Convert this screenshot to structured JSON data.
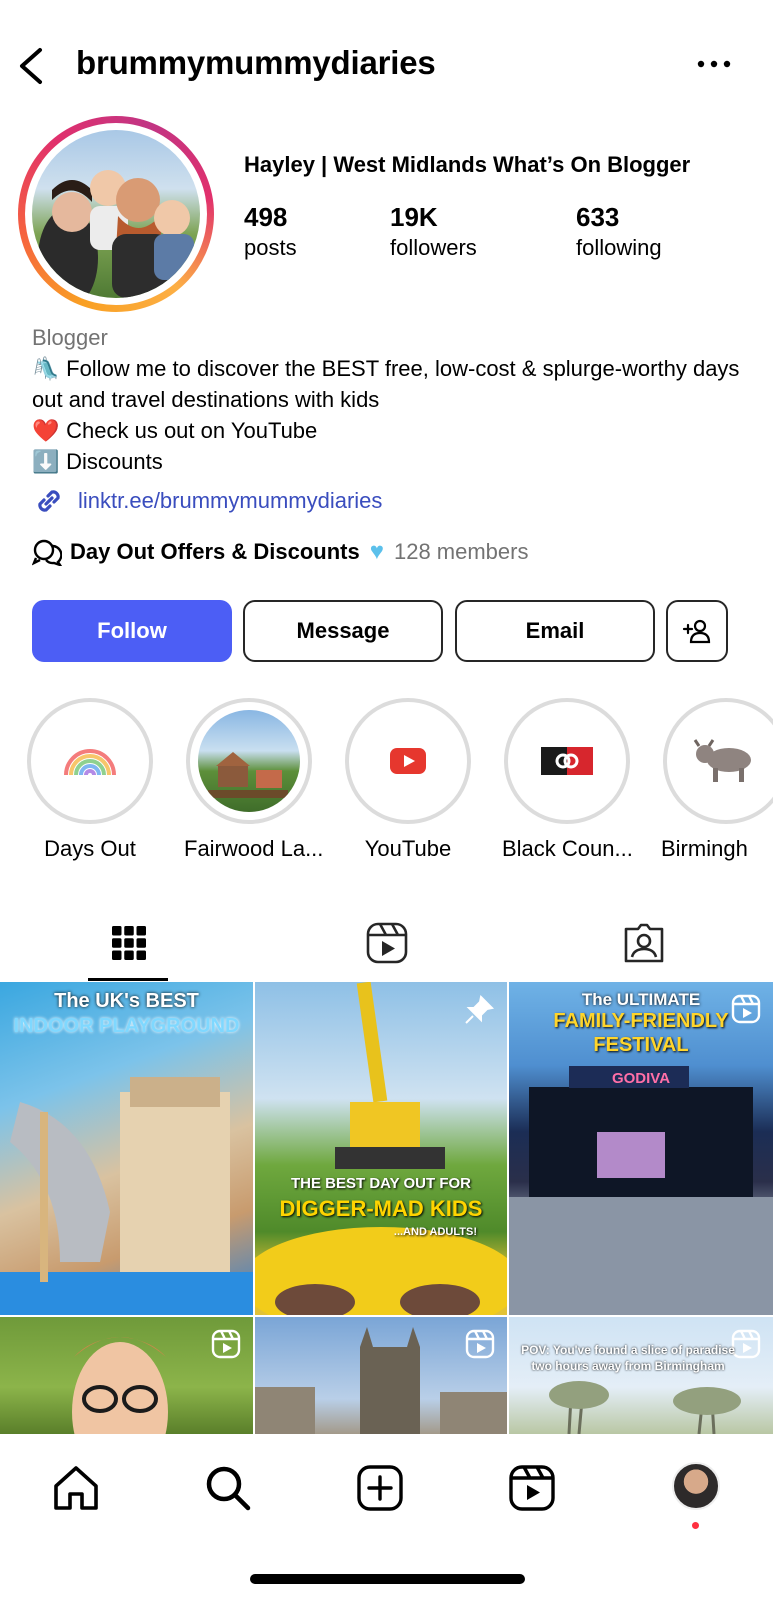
{
  "header": {
    "username": "brummymummydiaries",
    "back_icon": "chevron-left-icon",
    "more_icon": "ellipsis-icon"
  },
  "profile": {
    "display_name": "Hayley | West Midlands What’s On Blogger",
    "stats": [
      {
        "value": "498",
        "label": "posts"
      },
      {
        "value": "19K",
        "label": "followers"
      },
      {
        "value": "633",
        "label": "following"
      }
    ]
  },
  "bio": {
    "category": "Blogger",
    "lines": [
      {
        "emoji": "🛝",
        "text": "Follow me to discover the BEST free, low-cost & splurge-worthy days out and travel destinations with kids"
      },
      {
        "emoji": "❤️",
        "text": "Check us out on YouTube"
      },
      {
        "emoji": "⬇️",
        "text": "Discounts"
      }
    ],
    "link": "linktr.ee/brummymummydiaries"
  },
  "channel": {
    "name": "Day Out Offers & Discounts",
    "members": "128 members"
  },
  "actions": {
    "follow": "Follow",
    "message": "Message",
    "email": "Email",
    "add_user_icon": "add-person-icon"
  },
  "highlights": [
    {
      "label": "Days Out"
    },
    {
      "label": "Fairwood La..."
    },
    {
      "label": "YouTube"
    },
    {
      "label": "Black Coun..."
    },
    {
      "label": "Birmingh"
    }
  ],
  "posts": [
    {
      "overlay_line1": "The UK's BEST",
      "overlay_line2": "INDOOR PLAYGROUND"
    },
    {
      "overlay_line1": "THE BEST DAY OUT FOR",
      "overlay_line2": "DIGGER-MAD KIDS",
      "overlay_line3": "...AND ADULTS!"
    },
    {
      "overlay_line1": "The ULTIMATE",
      "overlay_line2": "FAMILY-FRIENDLY",
      "overlay_line3": "FESTIVAL",
      "sign": "GODIVA"
    },
    {
      "overlay_line1": ""
    },
    {
      "overlay_line1": ""
    },
    {
      "overlay_line1": "POV: You've found a slice of paradise",
      "overlay_line2": "two hours away from Birmingham"
    }
  ],
  "colors": {
    "follow_button": "#4c5ef5",
    "link": "#3a4dbe",
    "notification_dot": "#ff3040"
  }
}
